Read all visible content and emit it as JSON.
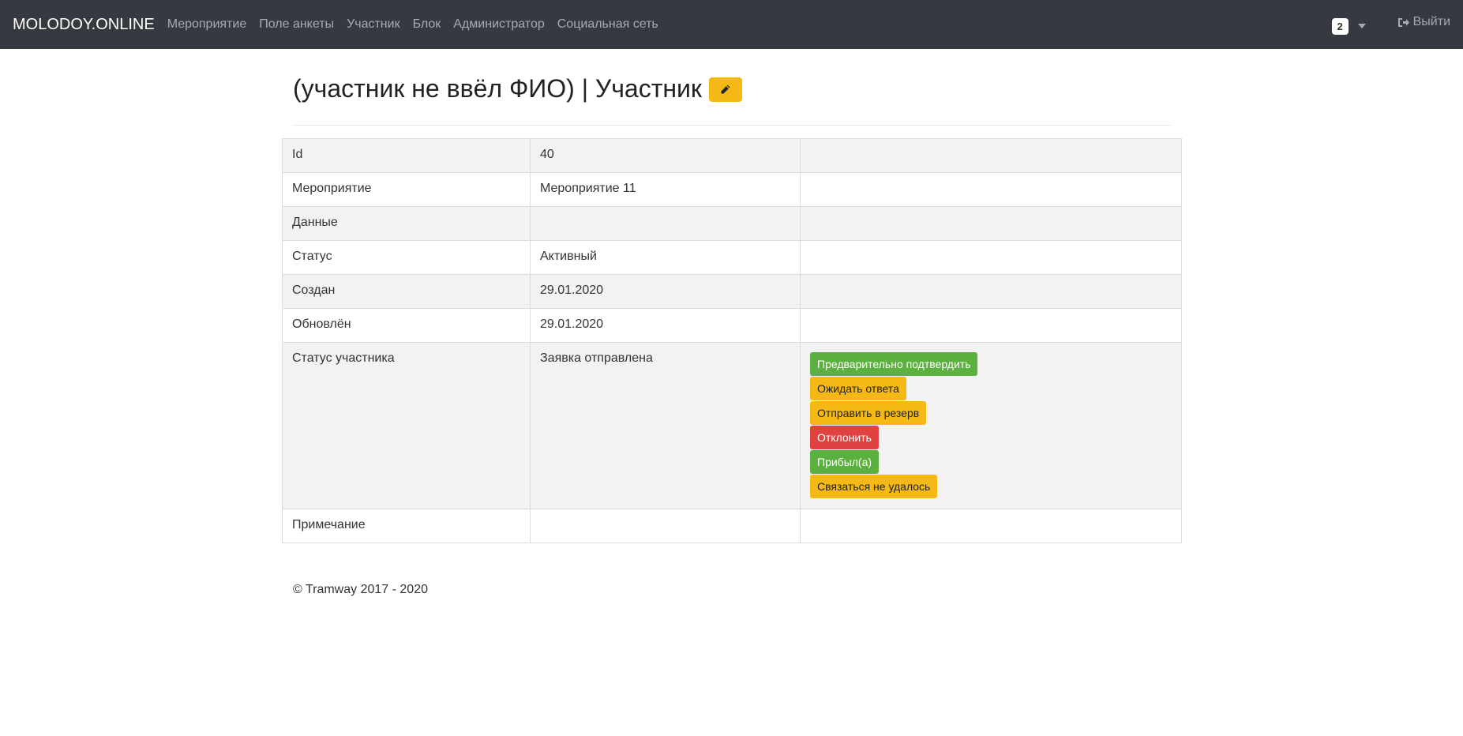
{
  "navbar": {
    "brand": "MOLODOY.ONLINE",
    "links": [
      "Мероприятие",
      "Поле анкеты",
      "Участник",
      "Блок",
      "Администратор",
      "Социальная сеть"
    ],
    "badge_count": "2",
    "logout_label": "Выйти"
  },
  "page": {
    "title": "(участник не ввёл ФИО) | Участник",
    "edit_icon": "pencil-icon"
  },
  "table": {
    "rows": [
      {
        "label": "Id",
        "value": "40"
      },
      {
        "label": "Мероприятие",
        "value": "Мероприятие 11"
      },
      {
        "label": "Данные",
        "value": ""
      },
      {
        "label": "Статус",
        "value": "Активный"
      },
      {
        "label": "Создан",
        "value": "29.01.2020"
      },
      {
        "label": "Обновлён",
        "value": "29.01.2020"
      },
      {
        "label": "Статус участника",
        "value": "Заявка отправлена"
      },
      {
        "label": "Примечание",
        "value": ""
      }
    ],
    "status_actions": [
      {
        "label": "Предварительно подтвердить",
        "color": "#5cb03f"
      },
      {
        "label": "Ожидать ответа",
        "color": "#f5b916"
      },
      {
        "label": "Отправить в резерв",
        "color": "#f5b916"
      },
      {
        "label": "Отклонить",
        "color": "#e04141"
      },
      {
        "label": "Прибыл(а)",
        "color": "#5cb03f"
      },
      {
        "label": "Связаться не удалось",
        "color": "#f5b916"
      }
    ]
  },
  "footer": {
    "copyright": "© Tramway 2017 - 2020"
  }
}
